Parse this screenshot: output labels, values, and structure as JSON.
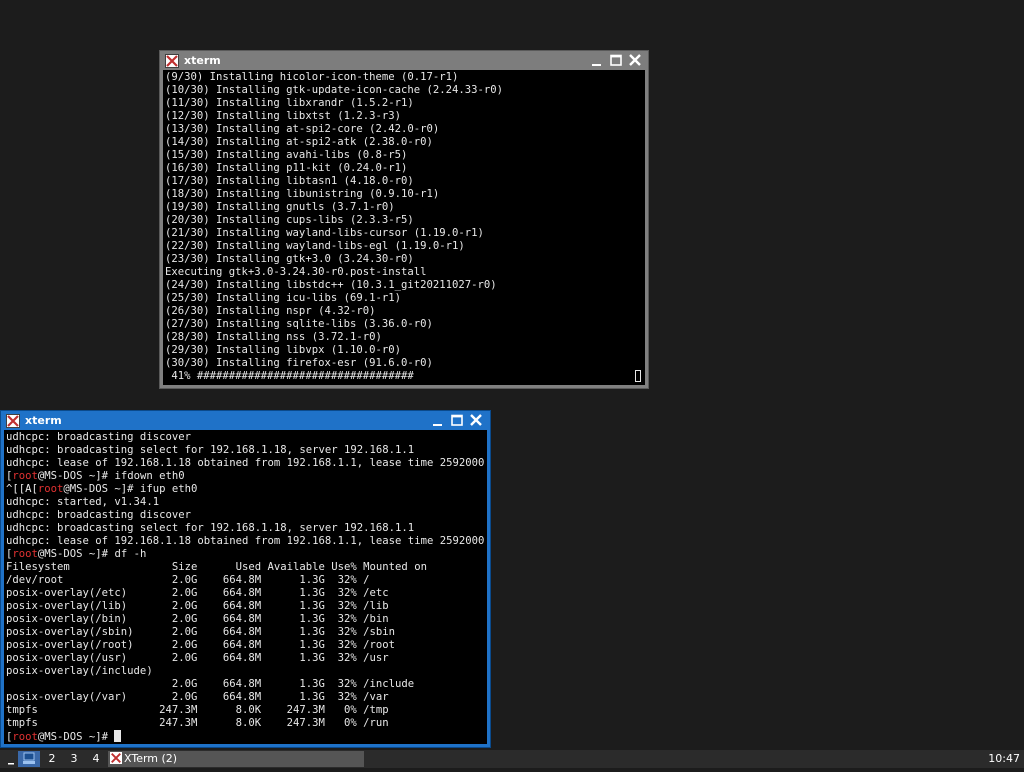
{
  "windows": [
    {
      "title": "xterm",
      "lines": [
        "(9/30) Installing hicolor-icon-theme (0.17-r1)",
        "(10/30) Installing gtk-update-icon-cache (2.24.33-r0)",
        "(11/30) Installing libxrandr (1.5.2-r1)",
        "(12/30) Installing libxtst (1.2.3-r3)",
        "(13/30) Installing at-spi2-core (2.42.0-r0)",
        "(14/30) Installing at-spi2-atk (2.38.0-r0)",
        "(15/30) Installing avahi-libs (0.8-r5)",
        "(16/30) Installing p11-kit (0.24.0-r1)",
        "(17/30) Installing libtasn1 (4.18.0-r0)",
        "(18/30) Installing libunistring (0.9.10-r1)",
        "(19/30) Installing gnutls (3.7.1-r0)",
        "(20/30) Installing cups-libs (2.3.3-r5)",
        "(21/30) Installing wayland-libs-cursor (1.19.0-r1)",
        "(22/30) Installing wayland-libs-egl (1.19.0-r1)",
        "(23/30) Installing gtk+3.0 (3.24.30-r0)",
        "Executing gtk+3.0-3.24.30-r0.post-install",
        "(24/30) Installing libstdc++ (10.3.1_git20211027-r0)",
        "(25/30) Installing icu-libs (69.1-r1)",
        "(26/30) Installing nspr (4.32-r0)",
        "(27/30) Installing sqlite-libs (3.36.0-r0)",
        "(28/30) Installing nss (3.72.1-r0)",
        "(29/30) Installing libvpx (1.10.0-r0)",
        "(30/30) Installing firefox-esr (91.6.0-r0)",
        " 41% ##################################"
      ]
    },
    {
      "title": "xterm",
      "lines": [
        {
          "t": "udhcpc: broadcasting discover"
        },
        {
          "t": "udhcpc: broadcasting select for 192.168.1.18, server 192.168.1.1"
        },
        {
          "t": "udhcpc: lease of 192.168.1.18 obtained from 192.168.1.1, lease time 2592000"
        },
        {
          "pre": "[",
          "red": "root",
          "post": "@MS-DOS ~]# ifdown eth0"
        },
        {
          "pre": "^[[A[",
          "red": "root",
          "post": "@MS-DOS ~]# ifup eth0"
        },
        {
          "t": "udhcpc: started, v1.34.1"
        },
        {
          "t": "udhcpc: broadcasting discover"
        },
        {
          "t": "udhcpc: broadcasting select for 192.168.1.18, server 192.168.1.1"
        },
        {
          "t": "udhcpc: lease of 192.168.1.18 obtained from 192.168.1.1, lease time 2592000"
        },
        {
          "pre": "[",
          "red": "root",
          "post": "@MS-DOS ~]# df -h"
        },
        {
          "t": "Filesystem                Size      Used Available Use% Mounted on"
        },
        {
          "t": "/dev/root                 2.0G    664.8M      1.3G  32% /"
        },
        {
          "t": "posix-overlay(/etc)       2.0G    664.8M      1.3G  32% /etc"
        },
        {
          "t": "posix-overlay(/lib)       2.0G    664.8M      1.3G  32% /lib"
        },
        {
          "t": "posix-overlay(/bin)       2.0G    664.8M      1.3G  32% /bin"
        },
        {
          "t": "posix-overlay(/sbin)      2.0G    664.8M      1.3G  32% /sbin"
        },
        {
          "t": "posix-overlay(/root)      2.0G    664.8M      1.3G  32% /root"
        },
        {
          "t": "posix-overlay(/usr)       2.0G    664.8M      1.3G  32% /usr"
        },
        {
          "t": "posix-overlay(/include)"
        },
        {
          "t": "                          2.0G    664.8M      1.3G  32% /include"
        },
        {
          "t": "posix-overlay(/var)       2.0G    664.8M      1.3G  32% /var"
        },
        {
          "t": "tmpfs                   247.3M      8.0K    247.3M   0% /tmp"
        },
        {
          "t": "tmpfs                   247.3M      8.0K    247.3M   0% /run"
        },
        {
          "pre": "[",
          "red": "root",
          "post": "@MS-DOS ~]# ",
          "cursor": true
        }
      ]
    }
  ],
  "taskbar": {
    "workspaces": [
      "2",
      "3",
      "4"
    ],
    "task_label": "XTerm (2)",
    "clock": "10:47"
  },
  "colors": {
    "active_title": "#1f72c8",
    "inactive_title": "#7d7d7d",
    "prompt_user": "#e03131"
  },
  "icons": [
    "xterm-icon",
    "minimize-icon",
    "maximize-icon",
    "close-icon",
    "desktop-icon"
  ]
}
